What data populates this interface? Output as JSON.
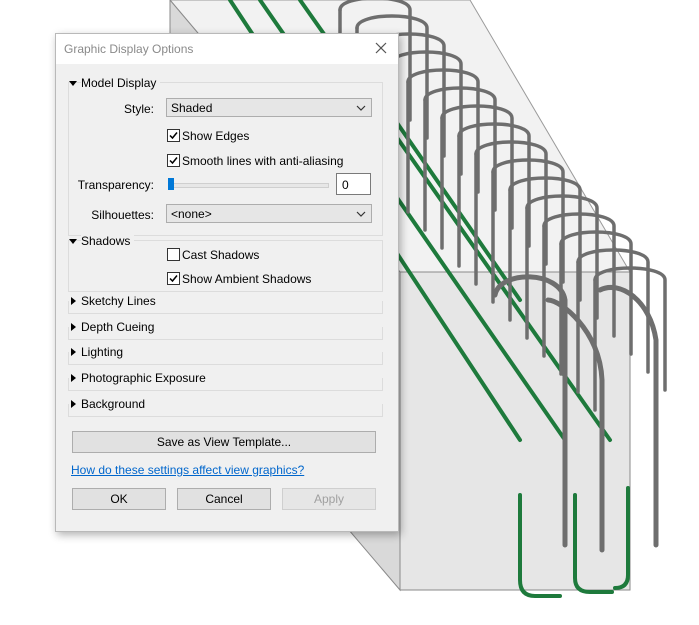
{
  "dialog": {
    "title": "Graphic Display Options",
    "close_icon": "close-icon"
  },
  "model_display": {
    "header": "Model Display",
    "style_label": "Style:",
    "style_value": "Shaded",
    "show_edges": {
      "label": "Show Edges",
      "checked": true
    },
    "smooth_lines": {
      "label": "Smooth lines with anti-aliasing",
      "checked": true
    },
    "transparency_label": "Transparency:",
    "transparency_value": "0",
    "transparency_level": 0,
    "silhouettes_label": "Silhouettes:",
    "silhouettes_value": "<none>"
  },
  "shadows": {
    "header": "Shadows",
    "cast_shadows": {
      "label": "Cast Shadows",
      "checked": false
    },
    "ambient_shadows": {
      "label": "Show Ambient Shadows",
      "checked": true
    }
  },
  "collapsed_sections": [
    "Sketchy Lines",
    "Depth Cueing",
    "Lighting",
    "Photographic Exposure",
    "Background"
  ],
  "buttons": {
    "save_template": "Save as View Template...",
    "ok": "OK",
    "cancel": "Cancel",
    "apply": "Apply"
  },
  "help_link": "How do these settings affect view graphics?",
  "colors": {
    "accent": "#0078d7",
    "rebar_gray": "#6e6e6e",
    "rebar_green": "#1e7a3c",
    "concrete": "#e4e4e4",
    "link": "#0066cc"
  }
}
